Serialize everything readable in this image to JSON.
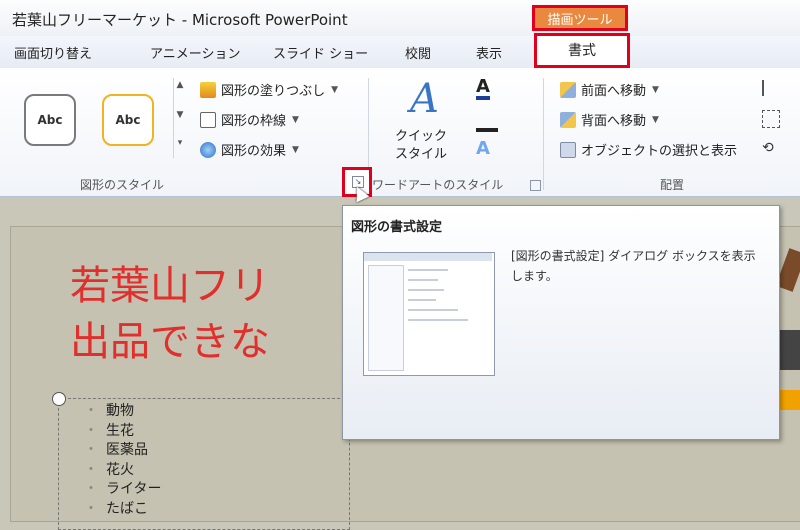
{
  "window": {
    "title": "若葉山フリーマーケット - Microsoft PowerPoint",
    "context_tab": "描画ツール"
  },
  "tabs": [
    {
      "label": "画面切り替え"
    },
    {
      "label": "アニメーション"
    },
    {
      "label": "スライド ショー"
    },
    {
      "label": "校閲"
    },
    {
      "label": "表示"
    },
    {
      "label": "書式"
    }
  ],
  "ribbon": {
    "shape_styles": {
      "group_label": "図形のスタイル",
      "presets": [
        {
          "label": "Abc"
        },
        {
          "label": "Abc"
        }
      ],
      "commands": [
        {
          "label": "図形の塗りつぶし"
        },
        {
          "label": "図形の枠線"
        },
        {
          "label": "図形の効果"
        }
      ]
    },
    "wordart": {
      "group_label": "ワードアートのスタイル",
      "quick_style": {
        "line1": "クイック",
        "line2": "スタイル"
      }
    },
    "arrange": {
      "group_label": "配置",
      "commands": [
        {
          "label": "前面へ移動"
        },
        {
          "label": "背面へ移動"
        },
        {
          "label": "オブジェクトの選択と表示"
        }
      ]
    }
  },
  "tooltip": {
    "title": "図形の書式設定",
    "description": "[図形の書式設定] ダイアログ ボックスを表示します。"
  },
  "slide": {
    "title_line1": "若葉山フリ",
    "title_line2": "出品できな",
    "bullets": [
      "動物",
      "生花",
      "医薬品",
      "花火",
      "ライター",
      "たばこ"
    ]
  },
  "colors": {
    "highlight": "#e0001b",
    "context_tab": "#e9893f",
    "slide_title": "#e0302e",
    "preset1_border": "#7a7a7a",
    "preset2_border": "#f2b320"
  }
}
